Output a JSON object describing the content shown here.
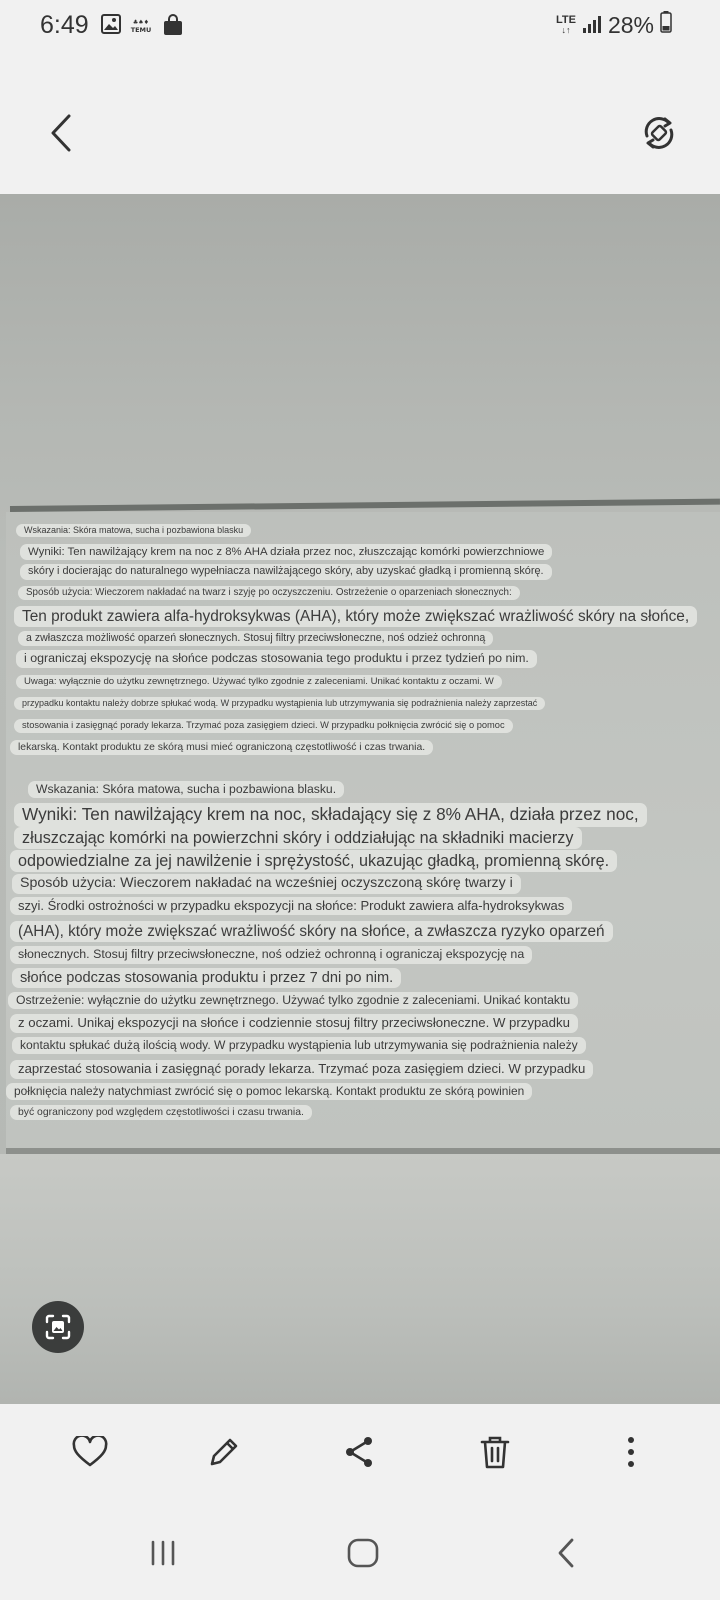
{
  "status_bar": {
    "time": "6:49",
    "network": "LTE",
    "battery": "28%"
  },
  "icons": {
    "back": "chevron-left-icon",
    "rotate": "auto-rotate-icon",
    "scan": "scan-text-icon",
    "favorite": "heart-icon",
    "edit": "pencil-icon",
    "share": "share-icon",
    "delete": "trash-icon",
    "more": "more-vertical-icon"
  },
  "overlay_text": {
    "block1": [
      "Wskazania: Skóra matowa, sucha i pozbawiona blasku",
      "Wyniki: Ten nawilżający krem na noc z 8% AHA działa przez noc, złuszczając komórki powierzchniowe",
      "skóry i docierając do naturalnego wypełniacza nawilżającego skóry, aby uzyskać gładką i promienną skórę.",
      "Sposób użycia: Wieczorem nakładać na twarz i szyję po oczyszczeniu. Ostrzeżenie o oparzeniach słonecznych:",
      "Ten produkt zawiera alfa-hydroksykwas (AHA), który może zwiększać wrażliwość skóry na słońce,",
      "a zwłaszcza możliwość oparzeń słonecznych. Stosuj filtry przeciwsłoneczne, noś odzież ochronną",
      "i ograniczaj ekspozycję na słońce podczas stosowania tego produktu i przez tydzień po nim.",
      "Uwaga: wyłącznie do użytku zewnętrznego. Używać tylko zgodnie z zaleceniami. Unikać kontaktu z oczami. W",
      "przypadku kontaktu należy dobrze spłukać wodą. W przypadku wystąpienia lub utrzymywania się podrażnienia należy zaprzestać",
      "stosowania i zasięgnąć porady lekarza. Trzymać poza zasięgiem dzieci. W przypadku połknięcia zwrócić się o pomoc",
      "lekarską. Kontakt produktu ze skórą musi mieć ograniczoną częstotliwość i czas trwania."
    ],
    "block2": [
      "Wskazania: Skóra matowa, sucha i pozbawiona blasku.",
      "Wyniki: Ten nawilżający krem na noc, składający się z 8% AHA, działa przez noc,",
      "złuszczając komórki na powierzchni skóry i oddziałując na składniki macierzy",
      "odpowiedzialne za jej nawilżenie i sprężystość, ukazując gładką, promienną skórę.",
      "Sposób użycia: Wieczorem nakładać na wcześniej oczyszczoną skórę twarzy i",
      "szyi. Środki ostrożności w przypadku ekspozycji na słońce: Produkt zawiera alfa-hydroksykwas",
      "(AHA), który może zwiększać wrażliwość skóry na słońce, a zwłaszcza ryzyko oparzeń",
      "słonecznych. Stosuj filtry przeciwsłoneczne, noś odzież ochronną i ograniczaj ekspozycję na",
      "słońce podczas stosowania produktu i przez 7 dni po nim.",
      "Ostrzeżenie: wyłącznie do użytku zewnętrznego. Używać tylko zgodnie z zaleceniami. Unikać kontaktu",
      "z oczami. Unikaj ekspozycji na słońce i codziennie stosuj filtry przeciwsłoneczne. W przypadku",
      "kontaktu spłukać dużą ilością wody. W przypadku wystąpienia lub utrzymywania się podrażnienia należy",
      "zaprzestać stosowania i zasięgnąć porady lekarza. Trzymać poza zasięgiem dzieci. W przypadku",
      "połknięcia należy natychmiast zwrócić się o pomoc lekarską. Kontakt produktu ze skórą powinien",
      "być ograniczony pod względem częstotliwości i czasu trwania."
    ]
  }
}
